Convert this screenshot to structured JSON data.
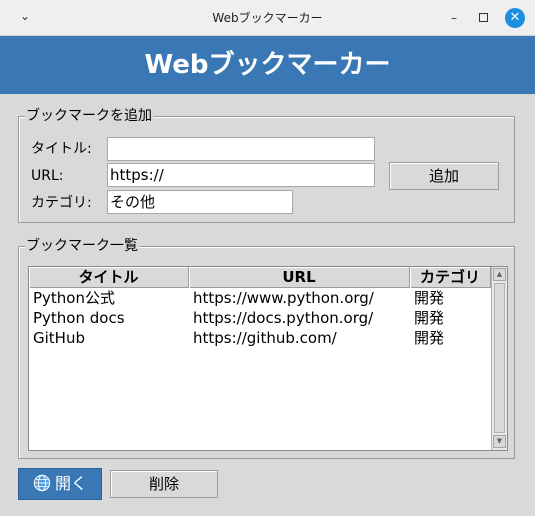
{
  "window": {
    "title": "Webブックマーカー",
    "menu_icon": "chevron-down-icon",
    "min_icon": "minimize-icon",
    "max_icon": "maximize-icon",
    "close_icon": "close-icon",
    "close_color": "#1d8fe0"
  },
  "banner": {
    "text": "Webブックマーカー",
    "bg_color": "#3a78b5"
  },
  "add_group": {
    "title": "ブックマークを追加",
    "title_label": "タイトル:",
    "title_value": "",
    "url_label": "URL:",
    "url_value": "https://",
    "category_label": "カテゴリ:",
    "category_value": "その他",
    "add_button": "追加"
  },
  "list_group": {
    "title": "ブックマーク一覧",
    "columns": [
      "タイトル",
      "URL",
      "カテゴリ"
    ],
    "rows": [
      {
        "title": "Python公式",
        "url": "https://www.python.org/",
        "category": "開発"
      },
      {
        "title": "Python docs",
        "url": "https://docs.python.org/",
        "category": "開発"
      },
      {
        "title": "GitHub",
        "url": "https://github.com/",
        "category": "開発"
      }
    ]
  },
  "actions": {
    "open_icon": "globe-icon",
    "open_label": "開く",
    "delete_label": "削除"
  }
}
